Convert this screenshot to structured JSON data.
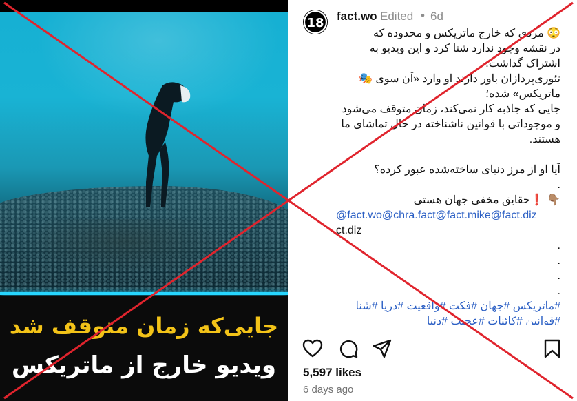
{
  "media": {
    "caption_line1": "جایی‌که زمان متوقف شد",
    "caption_line2": "ویدیو خارج از ماتریکس"
  },
  "post": {
    "username": "fact.wo",
    "edited_label": "Edited",
    "separator": "•",
    "age": "6d",
    "avatar_text": "18",
    "caption_lines": [
      {
        "text": "😳 مردی که خارج ماتریکس و محدوده که",
        "kind": "rtl"
      },
      {
        "text": "در نقشه وجود ندارد شنا کرد و این ویدیو به",
        "kind": "rtl"
      },
      {
        "text": "اشتراک گذاشت.",
        "kind": "rtl"
      },
      {
        "text": "تئوری‌پردازان باور دارند او وارد «آن سوی 🎭",
        "kind": "rtl"
      },
      {
        "text": "ماتریکس» شده؛",
        "kind": "rtl"
      },
      {
        "text": "جایی که جاذبه کار نمی‌کند، زمان متوقف می‌شود",
        "kind": "rtl"
      },
      {
        "text": "و موجوداتی با قوانین ناشناخته در حال تماشای ما",
        "kind": "rtl"
      },
      {
        "text": "هستند.",
        "kind": "rtl"
      },
      {
        "text": "",
        "kind": "rtl"
      },
      {
        "text": "آیا او از مرز دنیای ساخته‌شده عبور کرده؟",
        "kind": "rtl"
      },
      {
        "text": ".",
        "kind": "dot"
      },
      {
        "text": "👇🏽 ❗حقایق مخفی جهان هستی",
        "kind": "rtl"
      },
      {
        "text": "@fact.wo@chra.fact@fact.mike@fact.diz",
        "kind": "link"
      },
      {
        "text": "ct.diz",
        "kind": "ltr"
      },
      {
        "text": ".",
        "kind": "dot"
      },
      {
        "text": ".",
        "kind": "dot"
      },
      {
        "text": ".",
        "kind": "dot"
      },
      {
        "text": ".",
        "kind": "dot"
      },
      {
        "text": "#ماتریکس #جهان #فکت #واقعیت #دریا #شنا",
        "kind": "rtllink"
      },
      {
        "text": "#قوانین #کائنات #عجیب #دنیا",
        "kind": "rtllink"
      }
    ],
    "likes": "5,597 likes",
    "time_ago": "6 days ago"
  },
  "actions": {
    "icons": [
      "heart-icon",
      "comment-icon",
      "share-icon",
      "bookmark-icon"
    ]
  },
  "colors": {
    "overlay_x": "#e0242d",
    "link": "#2b5fc4",
    "caption_yellow": "#f3c318"
  }
}
